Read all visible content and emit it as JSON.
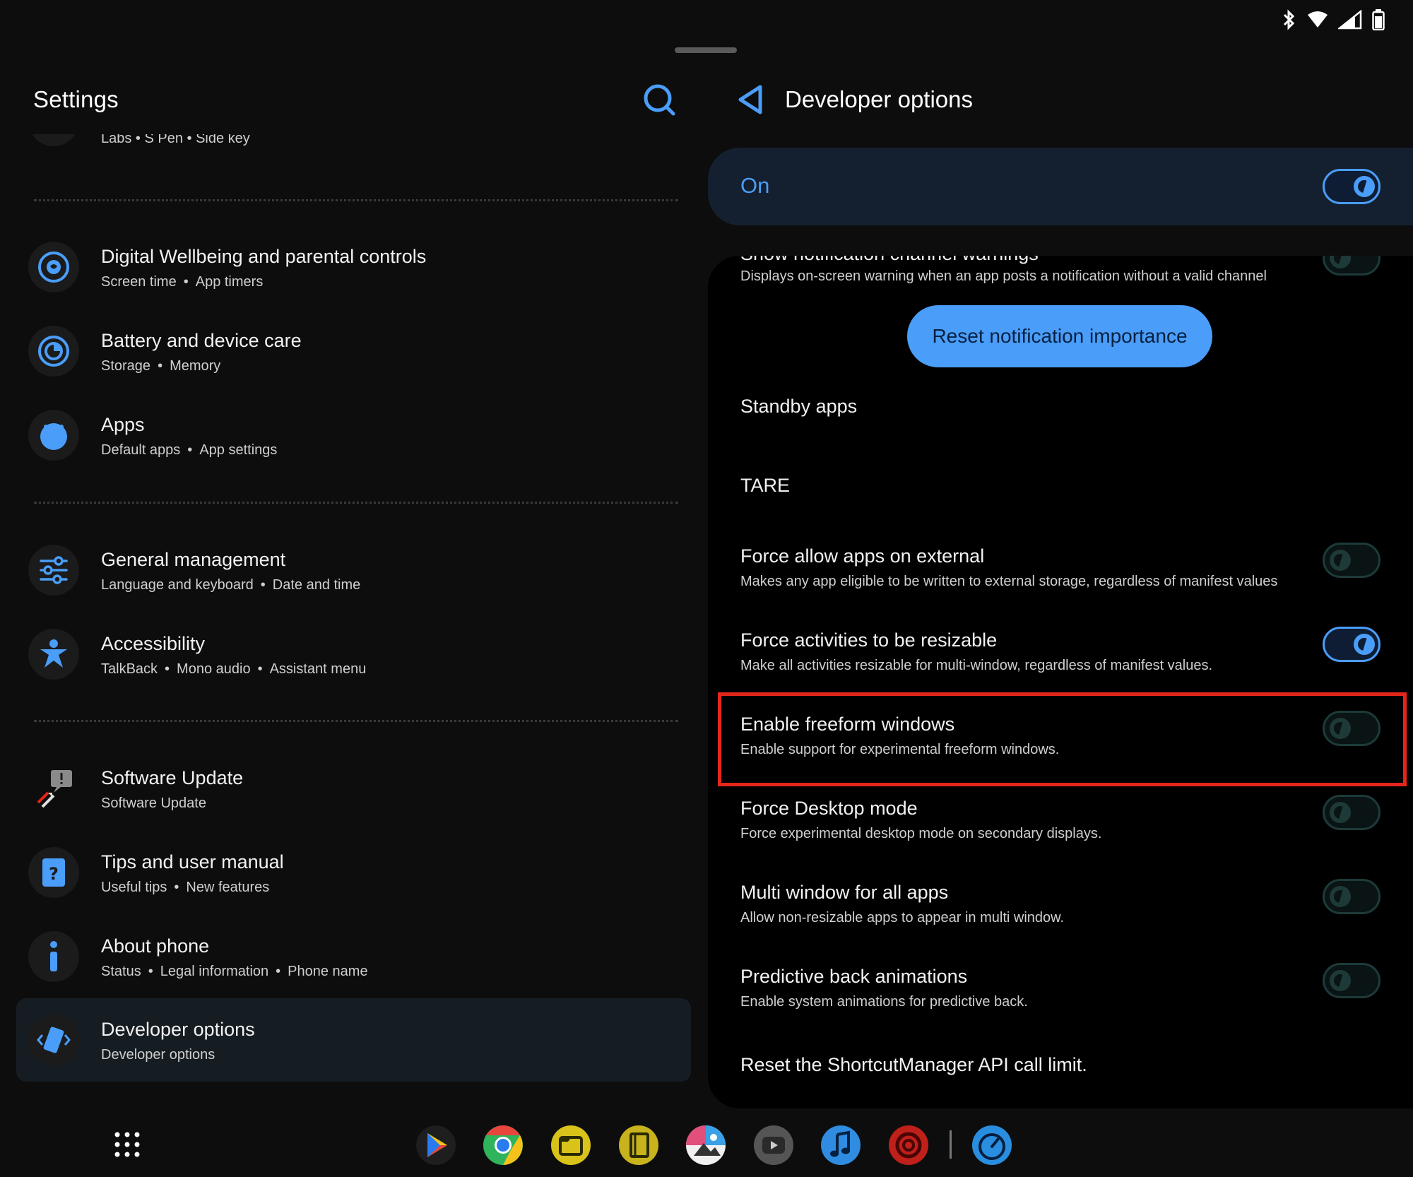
{
  "status_bar": {
    "icons": [
      "bluetooth-icon",
      "wifi-icon",
      "cell-signal-icon",
      "battery-icon"
    ]
  },
  "left": {
    "title": "Settings",
    "clipped_subtitle": "Labs  •  S Pen  •  Side key",
    "items": [
      {
        "title": "Digital Wellbeing and parental controls",
        "subs": [
          "Screen time",
          "App timers"
        ],
        "icon": "wellbeing-icon"
      },
      {
        "title": "Battery and device care",
        "subs": [
          "Storage",
          "Memory"
        ],
        "icon": "device-care-icon"
      },
      {
        "title": "Apps",
        "subs": [
          "Default apps",
          "App settings"
        ],
        "icon": "apps-icon"
      },
      {
        "title": "General management",
        "subs": [
          "Language and keyboard",
          "Date and time"
        ],
        "icon": "sliders-icon"
      },
      {
        "title": "Accessibility",
        "subs": [
          "TalkBack",
          "Mono audio",
          "Assistant menu"
        ],
        "icon": "accessibility-icon"
      },
      {
        "title": "Software Update",
        "subs": [
          "Software Update"
        ],
        "icon": "software-update-icon"
      },
      {
        "title": "Tips and user manual",
        "subs": [
          "Useful tips",
          "New features"
        ],
        "icon": "tips-icon"
      },
      {
        "title": "About phone",
        "subs": [
          "Status",
          "Legal information",
          "Phone name"
        ],
        "icon": "info-icon"
      },
      {
        "title": "Developer options",
        "subs": [
          "Developer options"
        ],
        "icon": "developer-icon"
      }
    ]
  },
  "right": {
    "title": "Developer options",
    "master_label": "On",
    "master_on": true,
    "clipped_title": "Show notification channel warnings",
    "clipped_desc": "Displays on-screen warning when an app posts a notification without a valid channel",
    "reset_button": "Reset notification importance",
    "standby": "Standby apps",
    "tare": "TARE",
    "rows": [
      {
        "title": "Force allow apps on external",
        "desc": "Makes any app eligible to be written to external storage, regardless of manifest values",
        "on": false
      },
      {
        "title": "Force activities to be resizable",
        "desc": "Make all activities resizable for multi-window, regardless of manifest values.",
        "on": true
      },
      {
        "title": "Enable freeform windows",
        "desc": "Enable support for experimental freeform windows.",
        "on": false
      },
      {
        "title": "Force Desktop mode",
        "desc": "Force experimental desktop mode on secondary displays.",
        "on": false
      },
      {
        "title": "Multi window for all apps",
        "desc": "Allow non-resizable apps to appear in multi window.",
        "on": false
      },
      {
        "title": "Predictive back animations",
        "desc": "Enable system animations for predictive back.",
        "on": false
      }
    ],
    "shortcut_reset": "Reset the ShortcutManager API call limit."
  },
  "dock": {
    "apps": [
      {
        "name": "play-store-icon",
        "color": "#1a1a1a"
      },
      {
        "name": "chrome-icon",
        "color": "#e8453c"
      },
      {
        "name": "files-icon",
        "color": "#d9c21a"
      },
      {
        "name": "notes-icon",
        "color": "#c8b31c"
      },
      {
        "name": "gallery-icon",
        "color": "#e24f7a"
      },
      {
        "name": "video-icon",
        "color": "#555555"
      },
      {
        "name": "music-icon",
        "color": "#2f8ce0"
      },
      {
        "name": "radio-icon",
        "color": "#c0201a"
      },
      {
        "name": "speedtest-icon",
        "color": "#2a8ee0"
      }
    ]
  }
}
